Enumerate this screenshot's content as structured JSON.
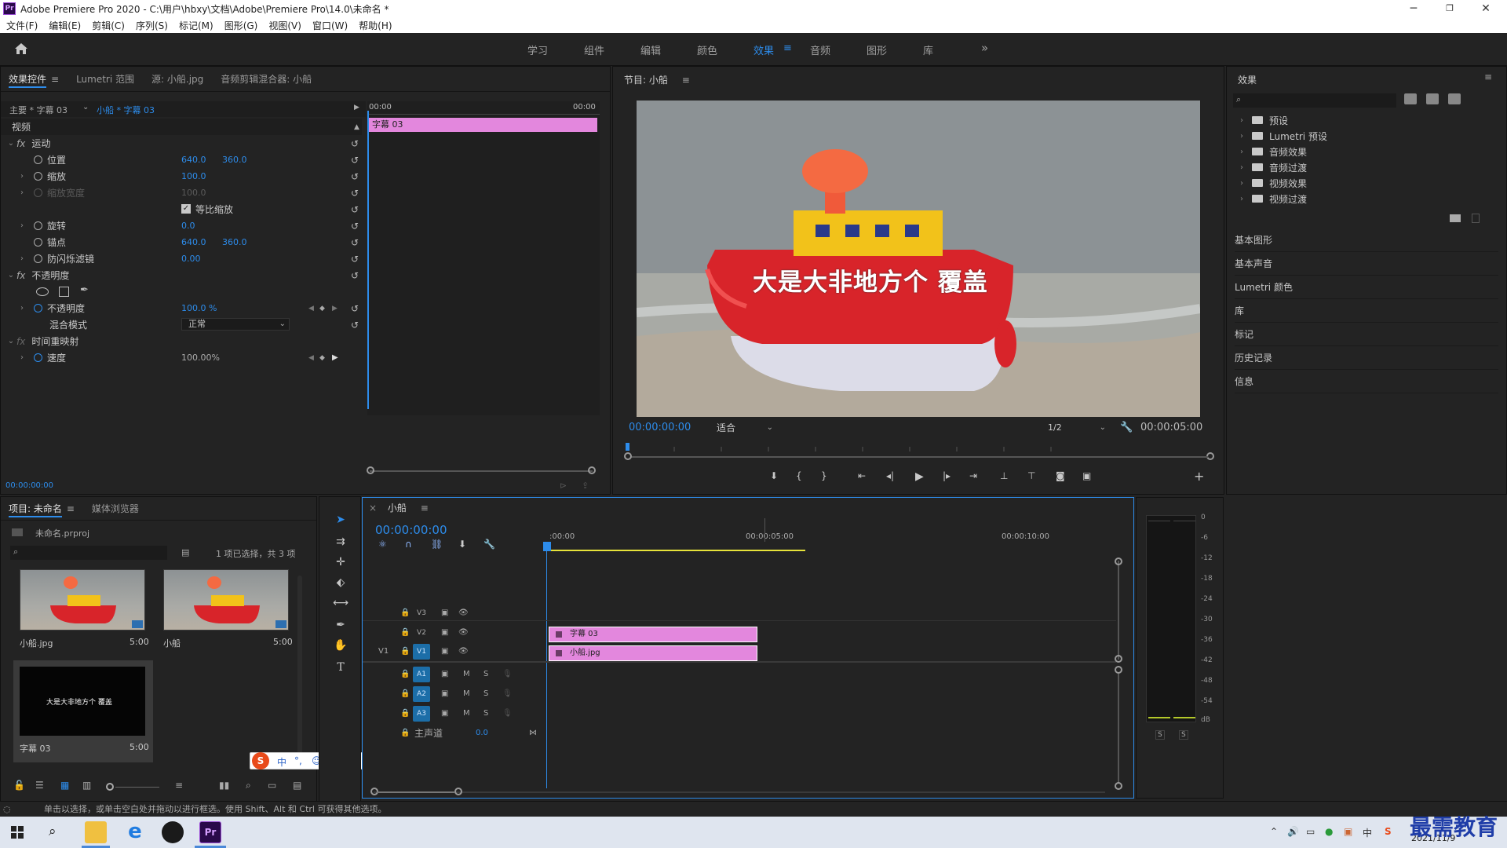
{
  "window": {
    "title": "Adobe Premiere Pro 2020 - C:\\用户\\hbxy\\文档\\Adobe\\Premiere Pro\\14.0\\未命名 *",
    "app_badge": "Pr",
    "minimize": "─",
    "maximize": "❐",
    "close": "✕"
  },
  "menu": [
    "文件(F)",
    "编辑(E)",
    "剪辑(C)",
    "序列(S)",
    "标记(M)",
    "图形(G)",
    "视图(V)",
    "窗口(W)",
    "帮助(H)"
  ],
  "workspaces": {
    "home_icon": "home-icon",
    "items": [
      "学习",
      "组件",
      "编辑",
      "颜色",
      "效果",
      "音频",
      "图形",
      "库"
    ],
    "active": "效果",
    "more": "»"
  },
  "effect_controls": {
    "tabs": [
      "效果控件",
      "Lumetri 范围",
      "源: 小船.jpg",
      "音频剪辑混合器: 小船"
    ],
    "master_label": "主要 * 字幕 03",
    "clip_label": "小船 * 字幕 03",
    "ruler_start": "00:00",
    "ruler_end": "00:00",
    "clip_name": "字幕 03",
    "section_video": "视频",
    "motion": "运动",
    "position_label": "位置",
    "position_x": "640.0",
    "position_y": "360.0",
    "scale_label": "缩放",
    "scale_value": "100.0",
    "scale_width_label": "缩放宽度",
    "scale_width_value": "100.0",
    "uniform_scale_label": "等比缩放",
    "rotation_label": "旋转",
    "rotation_value": "0.0",
    "anchor_label": "锚点",
    "anchor_x": "640.0",
    "anchor_y": "360.0",
    "antiflicker_label": "防闪烁滤镜",
    "antiflicker_value": "0.00",
    "opacity_section": "不透明度",
    "opacity_label": "不透明度",
    "opacity_value": "100.0 %",
    "blend_label": "混合模式",
    "blend_value": "正常",
    "time_remap": "时间重映射",
    "speed_label": "速度",
    "speed_value": "100.00%",
    "timecode": "00:00:00:00"
  },
  "program_monitor": {
    "title": "节目: 小船",
    "overlay_text": "大是大非地方个 覆盖",
    "timecode_current": "00:00:00:00",
    "fit_value": "适合",
    "resolution_value": "1/2",
    "timecode_duration": "00:00:05:00"
  },
  "effects_panel": {
    "title": "效果",
    "tree": [
      "预设",
      "Lumetri 预设",
      "音频效果",
      "音频过渡",
      "视频效果",
      "视频过渡"
    ],
    "sections": [
      "基本图形",
      "基本声音",
      "Lumetri 颜色",
      "库",
      "标记",
      "历史记录",
      "信息"
    ]
  },
  "project_panel": {
    "tabs": [
      "项目: 未命名",
      "媒体浏览器"
    ],
    "file_name": "未命名.prproj",
    "selection_info": "1 项已选择，共 3 项",
    "items": [
      {
        "name": "小船.jpg",
        "duration": "5:00"
      },
      {
        "name": "小船",
        "duration": "5:00"
      },
      {
        "name": "字幕 03",
        "duration": "5:00"
      }
    ],
    "subtitle_thumb_text": "大是大非地方个  覆盖"
  },
  "timeline": {
    "title": "小船",
    "timecode": "00:00:00:00",
    "ruler": [
      ":00:00",
      "00:00:05:00",
      "00:00:10:00"
    ],
    "video_tracks": [
      "V3",
      "V2",
      "V1"
    ],
    "audio_tracks": [
      "A1",
      "A2",
      "A3"
    ],
    "source_patch": "V1",
    "mute": "M",
    "solo": "S",
    "master_label": "主声道",
    "master_value": "0.0",
    "clips": {
      "v2": "字幕 03",
      "v1": "小船.jpg"
    }
  },
  "audio_meter": {
    "scale": [
      "0",
      "-6",
      "-12",
      "-18",
      "-24",
      "-30",
      "-36",
      "-42",
      "-48",
      "-54",
      "dB"
    ],
    "solo_left": "S",
    "solo_right": "S"
  },
  "status": "单击以选择，或单击空白处并拖动以进行框选。使用 Shift、Alt 和 Ctrl 可获得其他选项。",
  "taskbar": {
    "date": "2021/11/9",
    "watermark": "最需教育"
  },
  "colors": {
    "accent": "#2d8ceb",
    "clip": "#e387dd",
    "panel_bg": "#232323"
  }
}
